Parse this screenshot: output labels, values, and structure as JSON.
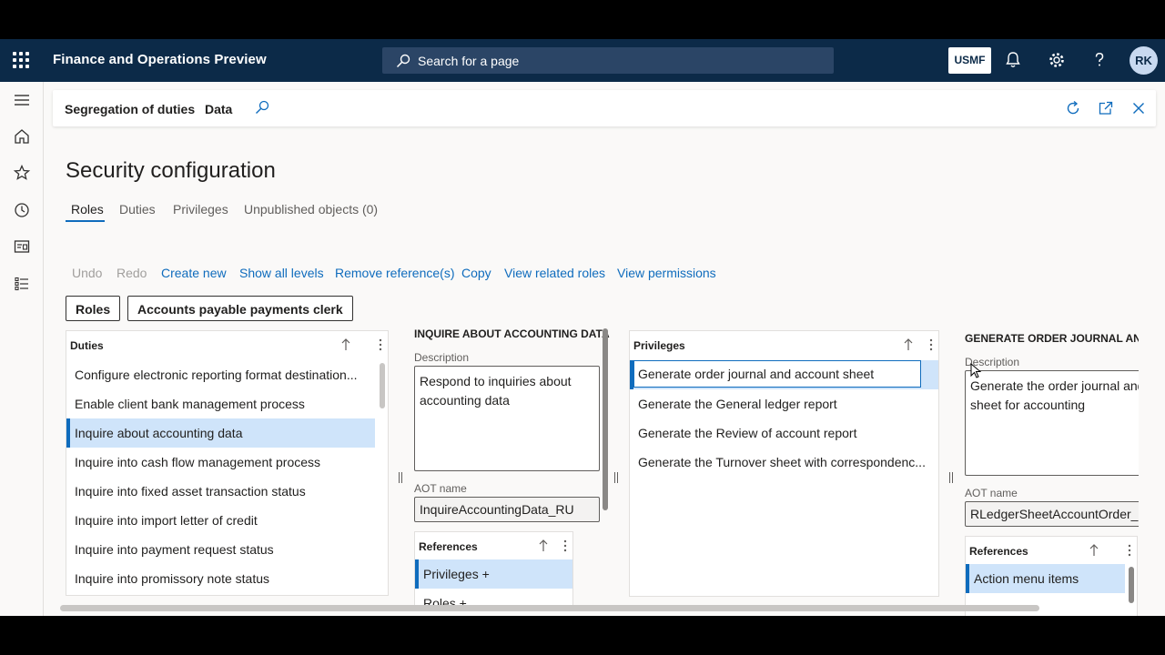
{
  "topbar": {
    "app_title": "Finance and Operations Preview",
    "search_placeholder": "Search for a page",
    "company": "USMF",
    "avatar_initials": "RK"
  },
  "actionbar": {
    "crumb": "Segregation of duties",
    "data_label": "Data"
  },
  "page": {
    "title": "Security configuration",
    "tabs": [
      "Roles",
      "Duties",
      "Privileges",
      "Unpublished objects (0)"
    ]
  },
  "toolbar": {
    "undo": "Undo",
    "redo": "Redo",
    "create_new": "Create new",
    "show_all_levels": "Show all levels",
    "remove_references": "Remove reference(s)",
    "copy": "Copy",
    "view_related_roles": "View related roles",
    "view_permissions": "View permissions"
  },
  "breadcrumb": {
    "roles": "Roles",
    "role": "Accounts payable payments clerk"
  },
  "duties_panel": {
    "header": "Duties",
    "items": [
      "Configure electronic reporting format destination...",
      "Enable client bank management process",
      "Inquire about accounting data",
      "Inquire into cash flow management process",
      "Inquire into fixed asset transaction status",
      "Inquire into import letter of credit",
      "Inquire into payment request status",
      "Inquire into promissory note status"
    ]
  },
  "duty_detail": {
    "title": "INQUIRE ABOUT ACCOUNTING DATA",
    "description_label": "Description",
    "description": "Respond to inquiries about accounting data",
    "aot_label": "AOT name",
    "aot_name": "InquireAccountingData_RU",
    "references_header": "References",
    "references": [
      "Privileges +",
      "Roles +"
    ]
  },
  "privileges_panel": {
    "header": "Privileges",
    "items": [
      "Generate order journal and account sheet",
      "Generate the General ledger report",
      "Generate the Review of account report",
      "Generate the Turnover sheet with correspondenc..."
    ]
  },
  "privilege_detail": {
    "title": "GENERATE ORDER JOURNAL AND A",
    "description_label": "Description",
    "description": "Generate the order journal and sheet for accounting",
    "aot_label": "AOT name",
    "aot_name": "RLedgerSheetAccountOrder_Ge",
    "references_header": "References",
    "references": [
      "Action menu items"
    ]
  }
}
